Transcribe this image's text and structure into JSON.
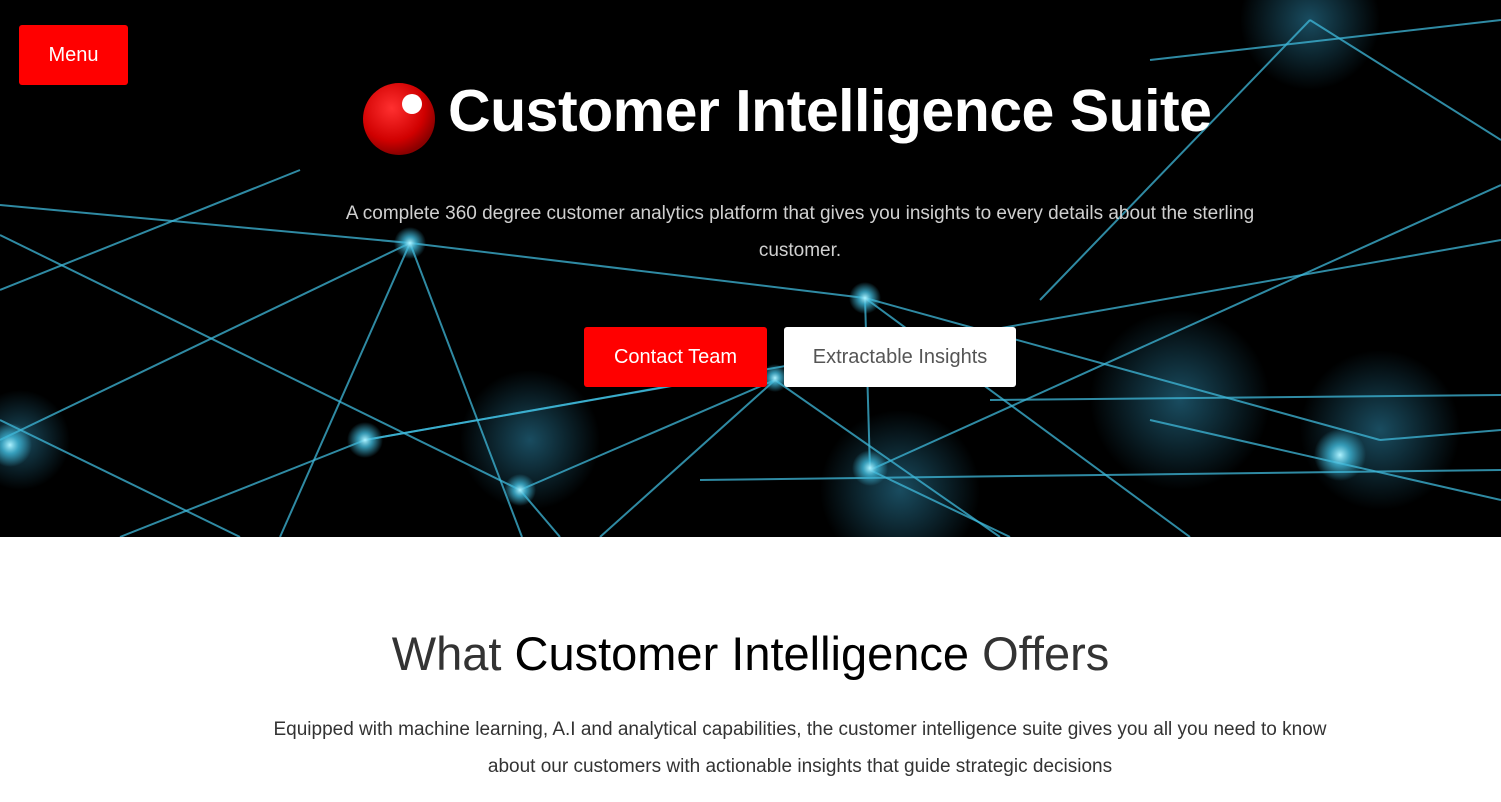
{
  "nav": {
    "menu_label": "Menu"
  },
  "hero": {
    "logo_icon": "red-sphere-logo-icon",
    "title": "Customer Intelligence Suite",
    "subtitle": "A complete 360 degree customer analytics platform that gives you insights to every details about the sterling customer.",
    "primary_button": "Contact Team",
    "secondary_button": "Extractable Insights",
    "background": "network-nodes-background"
  },
  "offers": {
    "heading_prefix": "What ",
    "heading_emphasis": "Customer Intelligence",
    "heading_suffix": " Offers",
    "description": "Equipped with machine learning, A.I and analytical capabilities, the customer intelligence suite gives you all you need to know about our customers with actionable insights that guide strategic decisions"
  },
  "colors": {
    "accent": "#ff0000",
    "hero_bg": "#000000",
    "network_line": "#3fb8d9",
    "text_dark": "#222222",
    "text_light": "#d0d0d0"
  }
}
